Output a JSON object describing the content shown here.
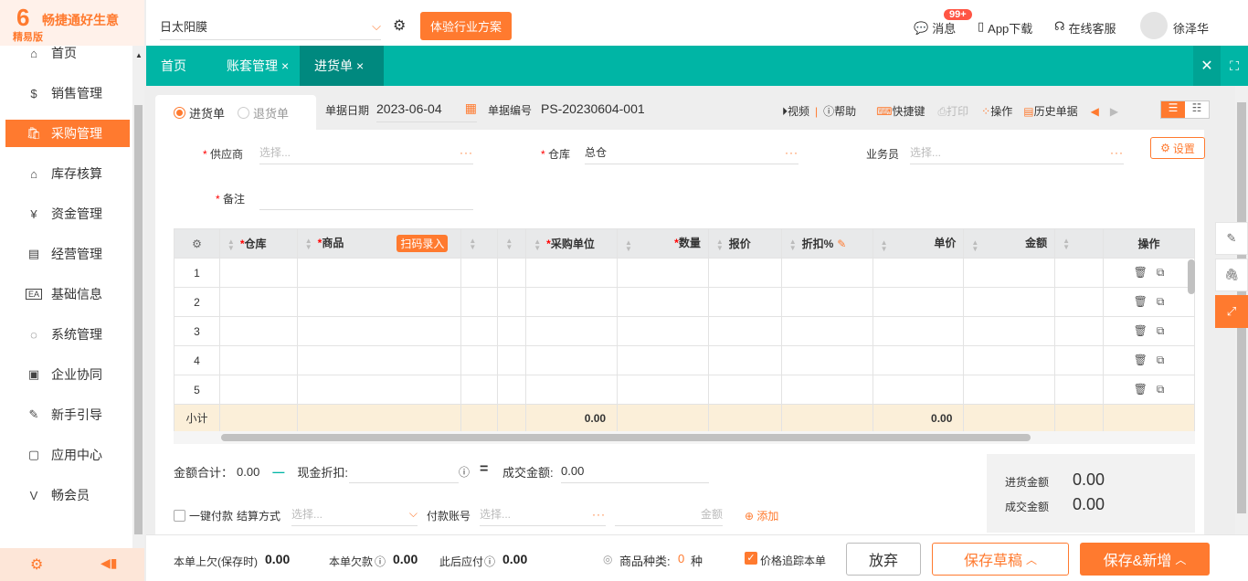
{
  "brand": {
    "name": "畅捷通好生意",
    "edition": "精易版",
    "accent": "#ff7a2f",
    "teal": "#00b5a5"
  },
  "sidebar": {
    "items": [
      {
        "label": "首页",
        "icon": "home-icon"
      },
      {
        "label": "销售管理",
        "icon": "sales-icon"
      },
      {
        "label": "采购管理",
        "icon": "purchase-bag-icon",
        "active": true
      },
      {
        "label": "库存核算",
        "icon": "warehouse-icon"
      },
      {
        "label": "资金管理",
        "icon": "money-bag-icon"
      },
      {
        "label": "经营管理",
        "icon": "clipboard-icon"
      },
      {
        "label": "基础信息",
        "icon": "info-card-icon"
      },
      {
        "label": "系统管理",
        "icon": "cycle-icon"
      },
      {
        "label": "企业协同",
        "icon": "collab-icon"
      },
      {
        "label": "新手引导",
        "icon": "guide-icon"
      },
      {
        "label": "应用中心",
        "icon": "app-tv-icon"
      },
      {
        "label": "畅会员",
        "icon": "vip-icon"
      }
    ]
  },
  "topbar": {
    "account": "日太阳膜",
    "trial_button": "体验行业方案",
    "messages": "消息",
    "badge": "99+",
    "app_download": "App下载",
    "online_service": "在线客服",
    "user": "徐泽华"
  },
  "tabs": [
    {
      "label": "首页"
    },
    {
      "label": "账套管理",
      "closable": true
    },
    {
      "label": "进货单",
      "closable": true,
      "active": true
    }
  ],
  "toolbar": {
    "type_purchase": "进货单",
    "type_return": "退货单",
    "date_label": "单据日期",
    "date": "2023-06-04",
    "no_label": "单据编号",
    "no": "PS-20230604-001",
    "video": "视频",
    "help": "帮助",
    "shortcut": "快捷键",
    "print": "打印",
    "operate": "操作",
    "history": "历史单据"
  },
  "form": {
    "supplier_label": "供应商",
    "supplier_placeholder": "选择...",
    "warehouse_label": "仓库",
    "warehouse_value": "总仓",
    "salesman_label": "业务员",
    "salesman_placeholder": "选择...",
    "remark_label": "备注",
    "settings": "设置"
  },
  "table": {
    "columns": [
      "仓库",
      "商品",
      "",
      "",
      "采购单位",
      "数量",
      "报价",
      "折扣%",
      "单价",
      "金额",
      "",
      "操作"
    ],
    "scan_button": "扫码录入",
    "rows": [
      "1",
      "2",
      "3",
      "4",
      "5"
    ],
    "subtotal_label": "小计",
    "subtotal_qty": "0.00",
    "subtotal_amount": "0.00"
  },
  "totals": {
    "sum_label": "金额合计：",
    "sum": "0.00",
    "discount_label": "现金折扣:",
    "deal_label": "成交金额:",
    "deal": "0.00"
  },
  "payment": {
    "one_click": "一键付款",
    "method_label": "结算方式",
    "method_placeholder": "选择...",
    "account_label": "付款账号",
    "account_placeholder": "选择...",
    "amount_placeholder": "金额",
    "add": "添加"
  },
  "summary": {
    "purchase_label": "进货金额",
    "purchase": "0.00",
    "deal_label": "成交金额",
    "deal": "0.00"
  },
  "footer": {
    "owed_saved_label": "本单上欠(保存时)",
    "owed_saved": "0.00",
    "owed_label": "本单欠款",
    "owed": "0.00",
    "payable_label": "此后应付",
    "payable": "0.00",
    "kinds_label": "商品种类:",
    "kinds": "0",
    "kinds_unit": "种",
    "track_price": "价格追踪本单",
    "discard": "放弃",
    "save_draft": "保存草稿",
    "save_new": "保存&新增"
  }
}
